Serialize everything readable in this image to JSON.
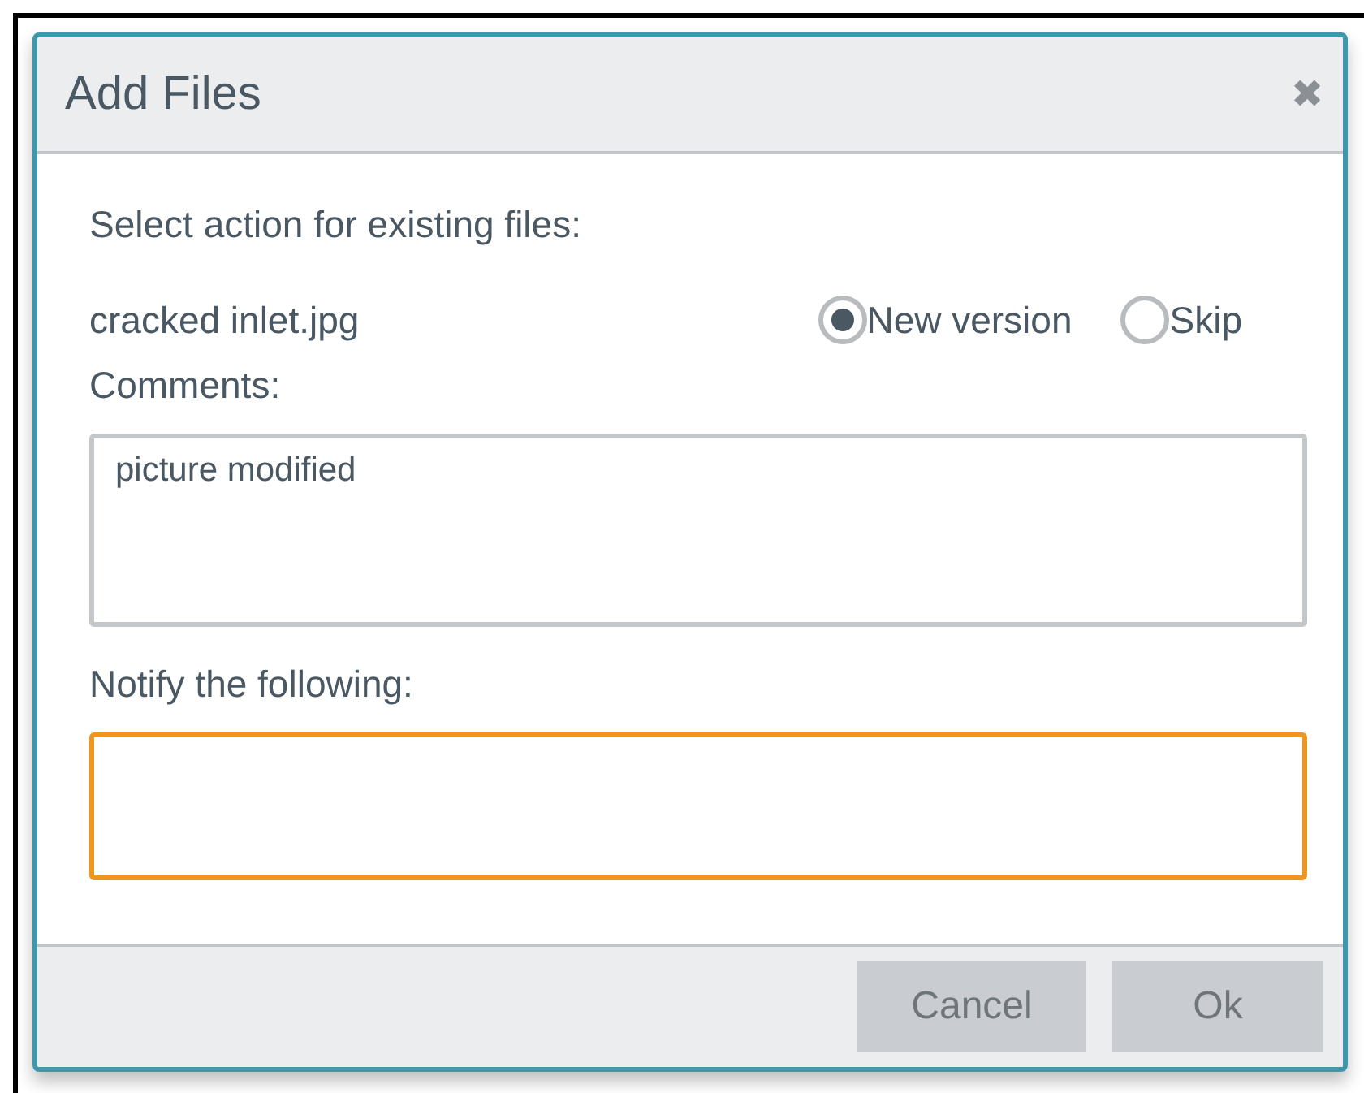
{
  "dialog": {
    "title": "Add Files",
    "close": "✖"
  },
  "prompt": "Select action for existing files:",
  "files": [
    {
      "name": "cracked inlet.jpg",
      "options": [
        {
          "label": "New version",
          "selected": true
        },
        {
          "label": "Skip",
          "selected": false
        }
      ]
    }
  ],
  "comments": {
    "label": "Comments:",
    "value": "picture modified"
  },
  "notify": {
    "label": "Notify the following:",
    "focused": true
  },
  "buttons": [
    {
      "label": "Cancel"
    },
    {
      "label": "Ok"
    }
  ]
}
